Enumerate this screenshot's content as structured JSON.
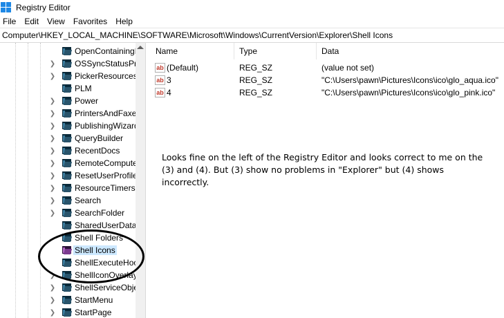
{
  "window": {
    "title": "Registry Editor",
    "app_icon": "registry-editor-icon"
  },
  "menu": [
    "File",
    "Edit",
    "View",
    "Favorites",
    "Help"
  ],
  "address": {
    "path": "Computer\\HKEY_LOCAL_MACHINE\\SOFTWARE\\Microsoft\\Windows\\CurrentVersion\\Explorer\\Shell Icons"
  },
  "tree": {
    "items": [
      {
        "label": "OpenContainingF",
        "expandable": false
      },
      {
        "label": "OSSyncStatusProv",
        "expandable": true
      },
      {
        "label": "PickerResources",
        "expandable": true
      },
      {
        "label": "PLM",
        "expandable": false
      },
      {
        "label": "Power",
        "expandable": true
      },
      {
        "label": "PrintersAndFaxes",
        "expandable": true
      },
      {
        "label": "PublishingWizard",
        "expandable": true
      },
      {
        "label": "QueryBuilder",
        "expandable": true
      },
      {
        "label": "RecentDocs",
        "expandable": true
      },
      {
        "label": "RemoteCompute",
        "expandable": true
      },
      {
        "label": "ResetUserProfileC",
        "expandable": true
      },
      {
        "label": "ResourceTimers",
        "expandable": true
      },
      {
        "label": "Search",
        "expandable": true
      },
      {
        "label": "SearchFolder",
        "expandable": true
      },
      {
        "label": "SharedUserData",
        "expandable": false
      },
      {
        "label": "Shell Folders",
        "expandable": false
      },
      {
        "label": "Shell Icons",
        "expandable": false,
        "selected": true
      },
      {
        "label": "ShellExecuteHool",
        "expandable": false
      },
      {
        "label": "ShellIconOverlayI",
        "expandable": true
      },
      {
        "label": "ShellServiceObjec",
        "expandable": true
      },
      {
        "label": "StartMenu",
        "expandable": true
      },
      {
        "label": "StartPage",
        "expandable": true
      }
    ]
  },
  "list": {
    "columns": {
      "name": "Name",
      "type": "Type",
      "data": "Data"
    },
    "rows": [
      {
        "name": "(Default)",
        "type": "REG_SZ",
        "data": "(value not set)"
      },
      {
        "name": "3",
        "type": "REG_SZ",
        "data": "\"C:\\Users\\pawn\\Pictures\\Icons\\ico\\glo_aqua.ico\""
      },
      {
        "name": "4",
        "type": "REG_SZ",
        "data": "\"C:\\Users\\pawn\\Pictures\\Icons\\ico\\glo_pink.ico\""
      }
    ]
  },
  "annotation": {
    "lines": [
      "Looks fine on the left of the Registry Editor and looks correct to me on the",
      "(3) and (4). But (3) show no problems in \"Explorer\" but (4) shows",
      "incorrectly."
    ]
  },
  "colors": {
    "selection": "#cce8ff",
    "icon_blue": "#1e88e5",
    "value_icon_red": "#c0392b",
    "circle": "#000000"
  }
}
